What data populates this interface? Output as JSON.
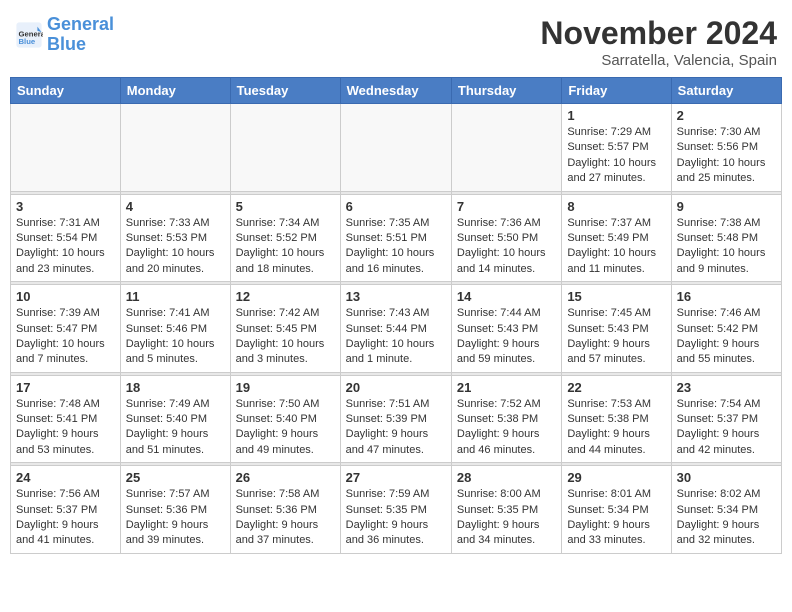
{
  "header": {
    "logo_line1": "General",
    "logo_line2": "Blue",
    "month": "November 2024",
    "location": "Sarratella, Valencia, Spain"
  },
  "days_of_week": [
    "Sunday",
    "Monday",
    "Tuesday",
    "Wednesday",
    "Thursday",
    "Friday",
    "Saturday"
  ],
  "weeks": [
    [
      {
        "day": "",
        "info": ""
      },
      {
        "day": "",
        "info": ""
      },
      {
        "day": "",
        "info": ""
      },
      {
        "day": "",
        "info": ""
      },
      {
        "day": "",
        "info": ""
      },
      {
        "day": "1",
        "info": "Sunrise: 7:29 AM\nSunset: 5:57 PM\nDaylight: 10 hours and 27 minutes."
      },
      {
        "day": "2",
        "info": "Sunrise: 7:30 AM\nSunset: 5:56 PM\nDaylight: 10 hours and 25 minutes."
      }
    ],
    [
      {
        "day": "3",
        "info": "Sunrise: 7:31 AM\nSunset: 5:54 PM\nDaylight: 10 hours and 23 minutes."
      },
      {
        "day": "4",
        "info": "Sunrise: 7:33 AM\nSunset: 5:53 PM\nDaylight: 10 hours and 20 minutes."
      },
      {
        "day": "5",
        "info": "Sunrise: 7:34 AM\nSunset: 5:52 PM\nDaylight: 10 hours and 18 minutes."
      },
      {
        "day": "6",
        "info": "Sunrise: 7:35 AM\nSunset: 5:51 PM\nDaylight: 10 hours and 16 minutes."
      },
      {
        "day": "7",
        "info": "Sunrise: 7:36 AM\nSunset: 5:50 PM\nDaylight: 10 hours and 14 minutes."
      },
      {
        "day": "8",
        "info": "Sunrise: 7:37 AM\nSunset: 5:49 PM\nDaylight: 10 hours and 11 minutes."
      },
      {
        "day": "9",
        "info": "Sunrise: 7:38 AM\nSunset: 5:48 PM\nDaylight: 10 hours and 9 minutes."
      }
    ],
    [
      {
        "day": "10",
        "info": "Sunrise: 7:39 AM\nSunset: 5:47 PM\nDaylight: 10 hours and 7 minutes."
      },
      {
        "day": "11",
        "info": "Sunrise: 7:41 AM\nSunset: 5:46 PM\nDaylight: 10 hours and 5 minutes."
      },
      {
        "day": "12",
        "info": "Sunrise: 7:42 AM\nSunset: 5:45 PM\nDaylight: 10 hours and 3 minutes."
      },
      {
        "day": "13",
        "info": "Sunrise: 7:43 AM\nSunset: 5:44 PM\nDaylight: 10 hours and 1 minute."
      },
      {
        "day": "14",
        "info": "Sunrise: 7:44 AM\nSunset: 5:43 PM\nDaylight: 9 hours and 59 minutes."
      },
      {
        "day": "15",
        "info": "Sunrise: 7:45 AM\nSunset: 5:43 PM\nDaylight: 9 hours and 57 minutes."
      },
      {
        "day": "16",
        "info": "Sunrise: 7:46 AM\nSunset: 5:42 PM\nDaylight: 9 hours and 55 minutes."
      }
    ],
    [
      {
        "day": "17",
        "info": "Sunrise: 7:48 AM\nSunset: 5:41 PM\nDaylight: 9 hours and 53 minutes."
      },
      {
        "day": "18",
        "info": "Sunrise: 7:49 AM\nSunset: 5:40 PM\nDaylight: 9 hours and 51 minutes."
      },
      {
        "day": "19",
        "info": "Sunrise: 7:50 AM\nSunset: 5:40 PM\nDaylight: 9 hours and 49 minutes."
      },
      {
        "day": "20",
        "info": "Sunrise: 7:51 AM\nSunset: 5:39 PM\nDaylight: 9 hours and 47 minutes."
      },
      {
        "day": "21",
        "info": "Sunrise: 7:52 AM\nSunset: 5:38 PM\nDaylight: 9 hours and 46 minutes."
      },
      {
        "day": "22",
        "info": "Sunrise: 7:53 AM\nSunset: 5:38 PM\nDaylight: 9 hours and 44 minutes."
      },
      {
        "day": "23",
        "info": "Sunrise: 7:54 AM\nSunset: 5:37 PM\nDaylight: 9 hours and 42 minutes."
      }
    ],
    [
      {
        "day": "24",
        "info": "Sunrise: 7:56 AM\nSunset: 5:37 PM\nDaylight: 9 hours and 41 minutes."
      },
      {
        "day": "25",
        "info": "Sunrise: 7:57 AM\nSunset: 5:36 PM\nDaylight: 9 hours and 39 minutes."
      },
      {
        "day": "26",
        "info": "Sunrise: 7:58 AM\nSunset: 5:36 PM\nDaylight: 9 hours and 37 minutes."
      },
      {
        "day": "27",
        "info": "Sunrise: 7:59 AM\nSunset: 5:35 PM\nDaylight: 9 hours and 36 minutes."
      },
      {
        "day": "28",
        "info": "Sunrise: 8:00 AM\nSunset: 5:35 PM\nDaylight: 9 hours and 34 minutes."
      },
      {
        "day": "29",
        "info": "Sunrise: 8:01 AM\nSunset: 5:34 PM\nDaylight: 9 hours and 33 minutes."
      },
      {
        "day": "30",
        "info": "Sunrise: 8:02 AM\nSunset: 5:34 PM\nDaylight: 9 hours and 32 minutes."
      }
    ]
  ]
}
